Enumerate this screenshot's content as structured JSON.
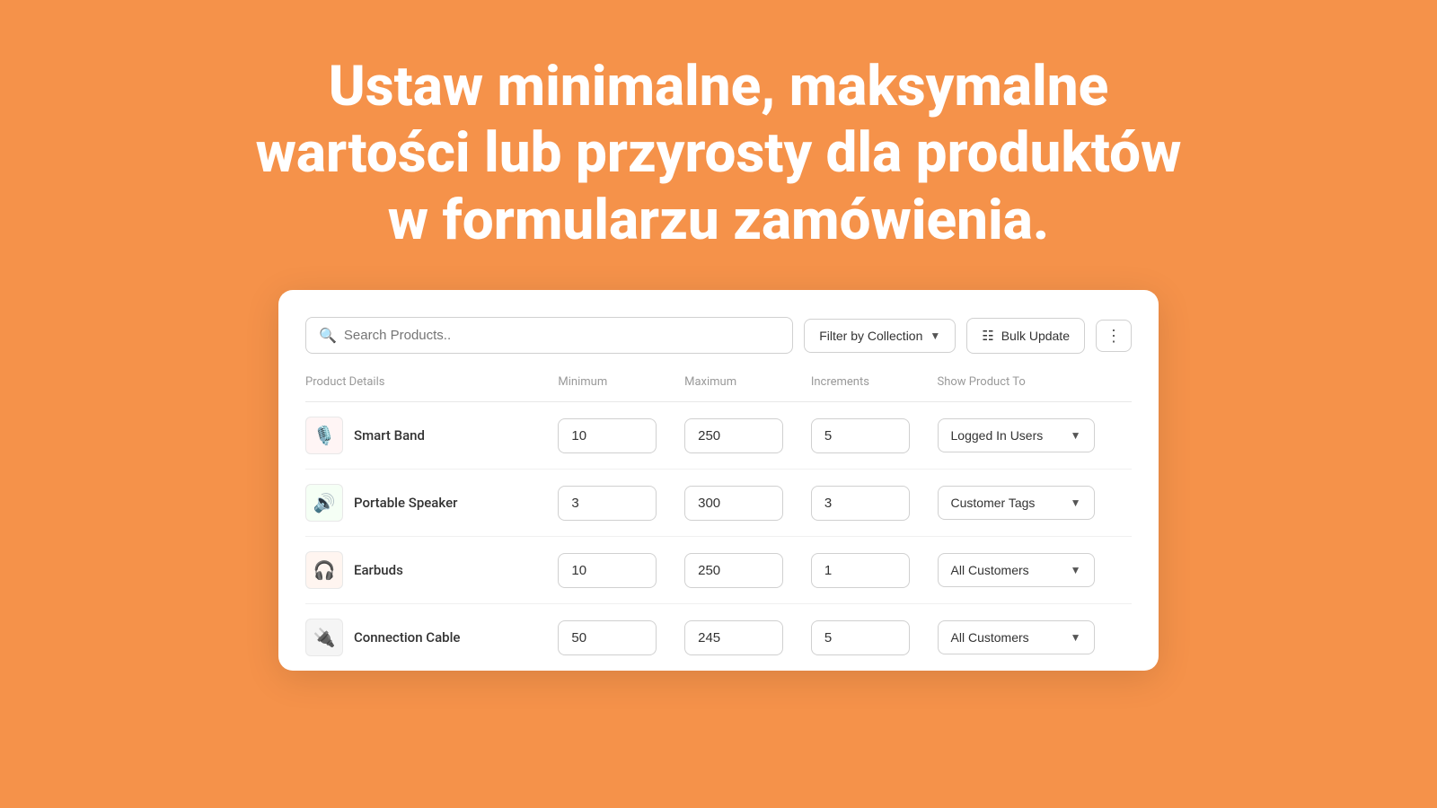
{
  "hero": {
    "line1": "Ustaw minimalne, maksymalne",
    "line2": "wartości lub przyrosty dla produktów",
    "line3": "w formularzu zamówienia."
  },
  "toolbar": {
    "search_placeholder": "Search Products..",
    "filter_label": "Filter by Collection",
    "bulk_label": "Bulk Update",
    "more_icon": "⋮"
  },
  "table": {
    "headers": {
      "product": "Product Details",
      "minimum": "Minimum",
      "maximum": "Maximum",
      "increments": "Increments",
      "show_product": "Show Product To"
    },
    "rows": [
      {
        "id": "smart-band",
        "name": "Smart Band",
        "emoji": "🎙️",
        "min": "10",
        "max": "250",
        "inc": "5",
        "show": "Logged In Users"
      },
      {
        "id": "portable-speaker",
        "name": "Portable Speaker",
        "emoji": "🔊",
        "min": "3",
        "max": "300",
        "inc": "3",
        "show": "Customer Tags"
      },
      {
        "id": "earbuds",
        "name": "Earbuds",
        "emoji": "🎧",
        "min": "10",
        "max": "250",
        "inc": "1",
        "show": "All Customers"
      },
      {
        "id": "connection-cable",
        "name": "Connection Cable",
        "emoji": "🔌",
        "min": "50",
        "max": "245",
        "inc": "5",
        "show": "All Customers"
      }
    ]
  }
}
